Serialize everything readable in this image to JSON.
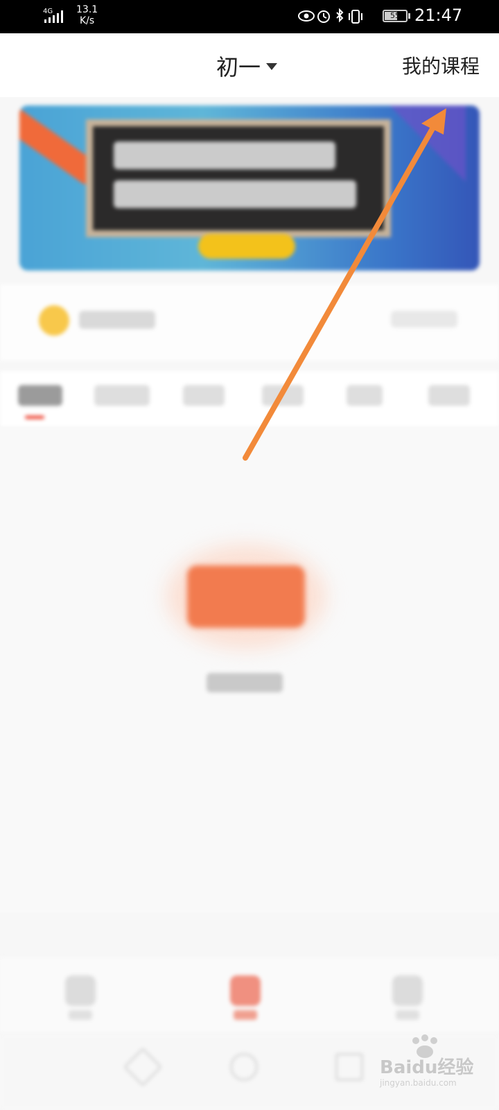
{
  "status_bar": {
    "network": "4G",
    "speed": "13.1",
    "speed_unit": "K/s",
    "battery": "55",
    "time": "21:47"
  },
  "header": {
    "grade": "初一",
    "my_course": "我的课程"
  },
  "watermark": {
    "brand": "Baidu经验",
    "site": "jingyan.baidu.com"
  },
  "colors": {
    "accent": "#ee4b3a",
    "arrow": "#f28a3a"
  }
}
